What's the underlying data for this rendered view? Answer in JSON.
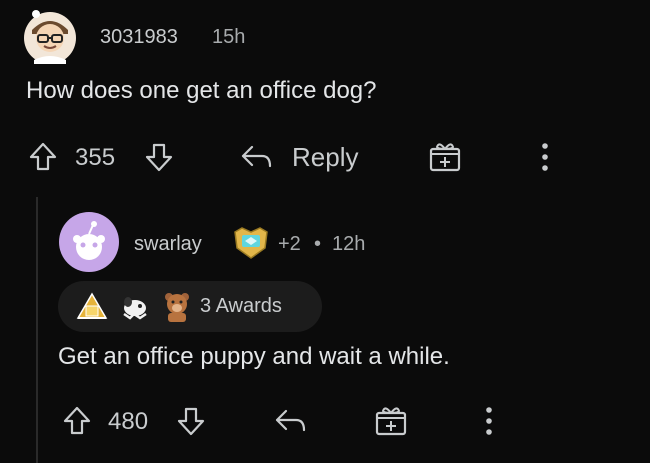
{
  "parent_comment": {
    "username": "3031983",
    "time": "15h",
    "text": "How does one get an office dog?",
    "upvotes": "355",
    "reply_label": "Reply"
  },
  "child_comment": {
    "username": "swarlay",
    "karma_delta": "+2",
    "separator": "•",
    "time": "12h",
    "awards_label": "3 Awards",
    "text": "Get an office puppy and wait a while.",
    "upvotes": "480"
  },
  "icons": {
    "upvote": "arrow-up-icon",
    "downvote": "arrow-down-icon",
    "reply": "reply-arrow-icon",
    "award": "gift-icon",
    "more": "more-vertical-icon"
  },
  "colors": {
    "background": "#0b0b0b",
    "text": "#d7dadc",
    "avatar_purple": "#c6a6e8",
    "award_pill": "#1c1c1c"
  }
}
